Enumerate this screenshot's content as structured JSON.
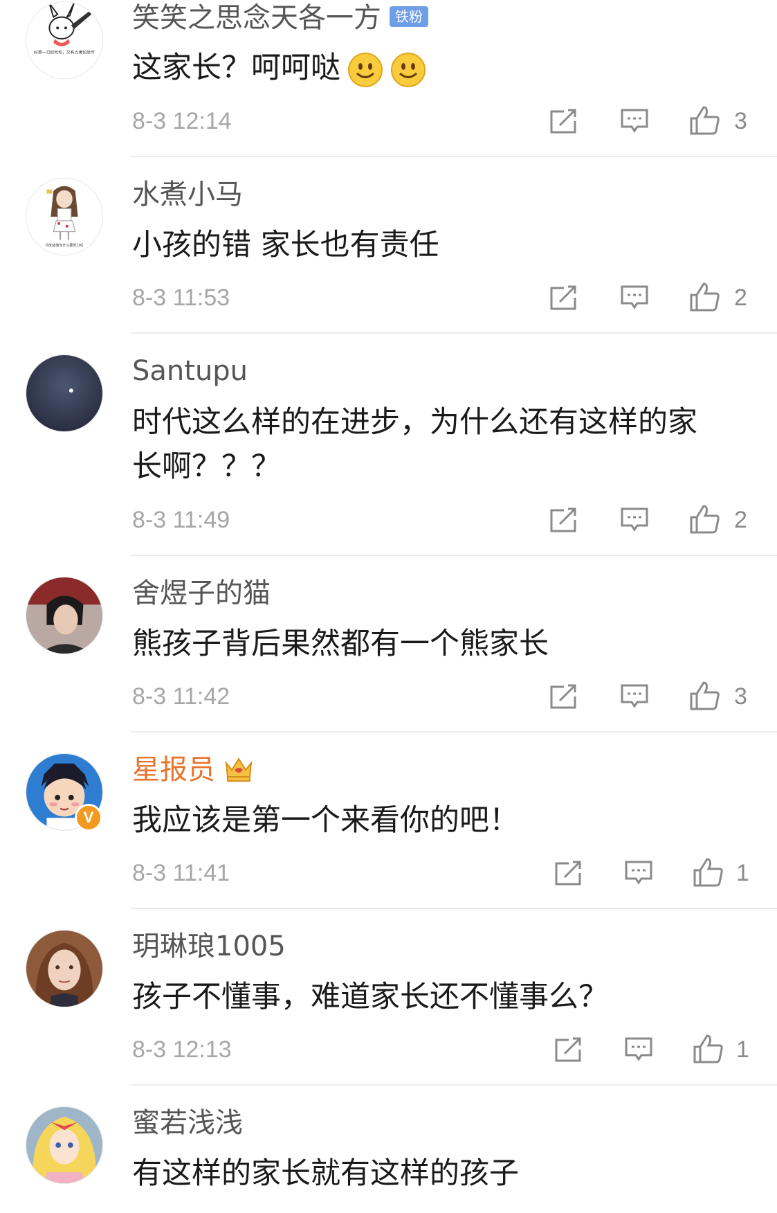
{
  "comments": [
    {
      "user": "笑笑之思念天各一方",
      "badge": "铁粉",
      "text": "这家长？呵呵哒",
      "time": "8-3 12:14",
      "likes": "3"
    },
    {
      "user": "水煮小马",
      "text": "小孩的错 家长也有责任",
      "time": "8-3 11:53",
      "likes": "2"
    },
    {
      "user": "Santupu",
      "text_line1": "时代这么样的在进步，为什么还有这样的家",
      "text_line2": "长啊？？？",
      "time": "8-3 11:49",
      "likes": "2"
    },
    {
      "user": "舍煜子的猫",
      "text": "熊孩子背后果然都有一个熊家长",
      "time": "8-3 11:42",
      "likes": "3"
    },
    {
      "user": "星报员",
      "verified": "V",
      "text": "我应该是第一个来看你的吧！",
      "time": "8-3 11:41",
      "likes": "1"
    },
    {
      "user": "玥琳琅1005",
      "text": "孩子不懂事，难道家长还不懂事么？",
      "time": "8-3 12:13",
      "likes": "1"
    },
    {
      "user": "蜜若浅浅",
      "text": "有这样的家长就有这样的孩子"
    }
  ],
  "avatar1_caption": "好想一刀砍死你，又有点害怕坐牢",
  "avatar2_caption": "你知道我为什么要努力吗",
  "icons": {
    "share": "share-icon",
    "comment": "comment-icon",
    "like": "thumbs-up-icon",
    "smile": "smile-emoji",
    "crown": "crown-icon"
  },
  "colors": {
    "username": "#555555",
    "highlight_user": "#e8742a",
    "badge": "#6f9ee8",
    "time": "#a6a6a6"
  }
}
